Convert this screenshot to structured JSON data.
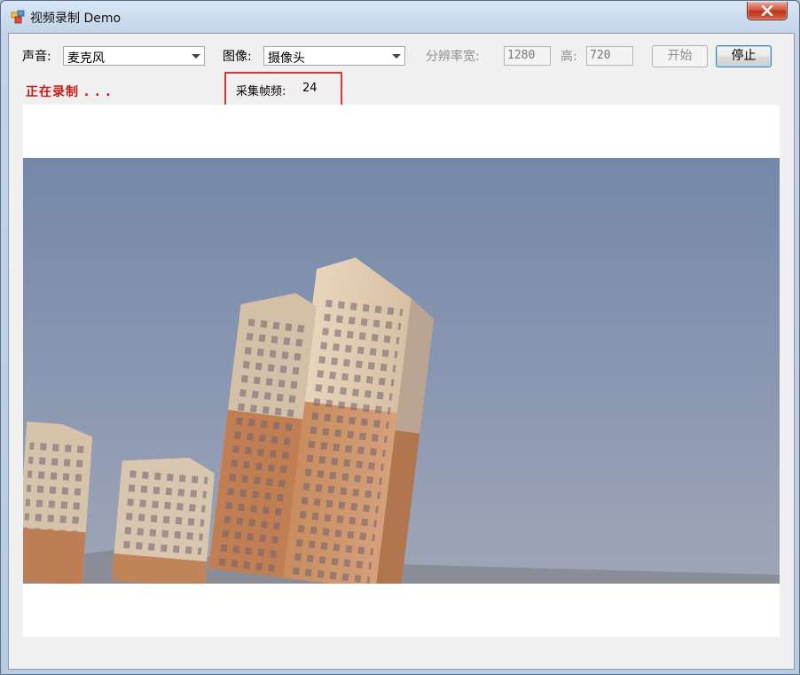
{
  "window": {
    "title": "视频录制 Demo"
  },
  "controls": {
    "audio_label": "声音:",
    "audio_selected": "麦克风",
    "video_label": "图像:",
    "video_selected": "摄像头",
    "resolution_width_label": "分辨率宽:",
    "width_value": "1280",
    "height_label": "高:",
    "height_value": "720",
    "start_label": "开始",
    "stop_label": "停止"
  },
  "status": {
    "recording_text": "正在录制 . . .",
    "fps_label": "采集帧频:",
    "fps_value": "24"
  },
  "icons": {
    "app": "app-window-icon",
    "close": "close-icon",
    "dropdown": "chevron-down-icon"
  },
  "colors": {
    "recording_text": "#c81818",
    "highlight_box": "#d7383b"
  }
}
